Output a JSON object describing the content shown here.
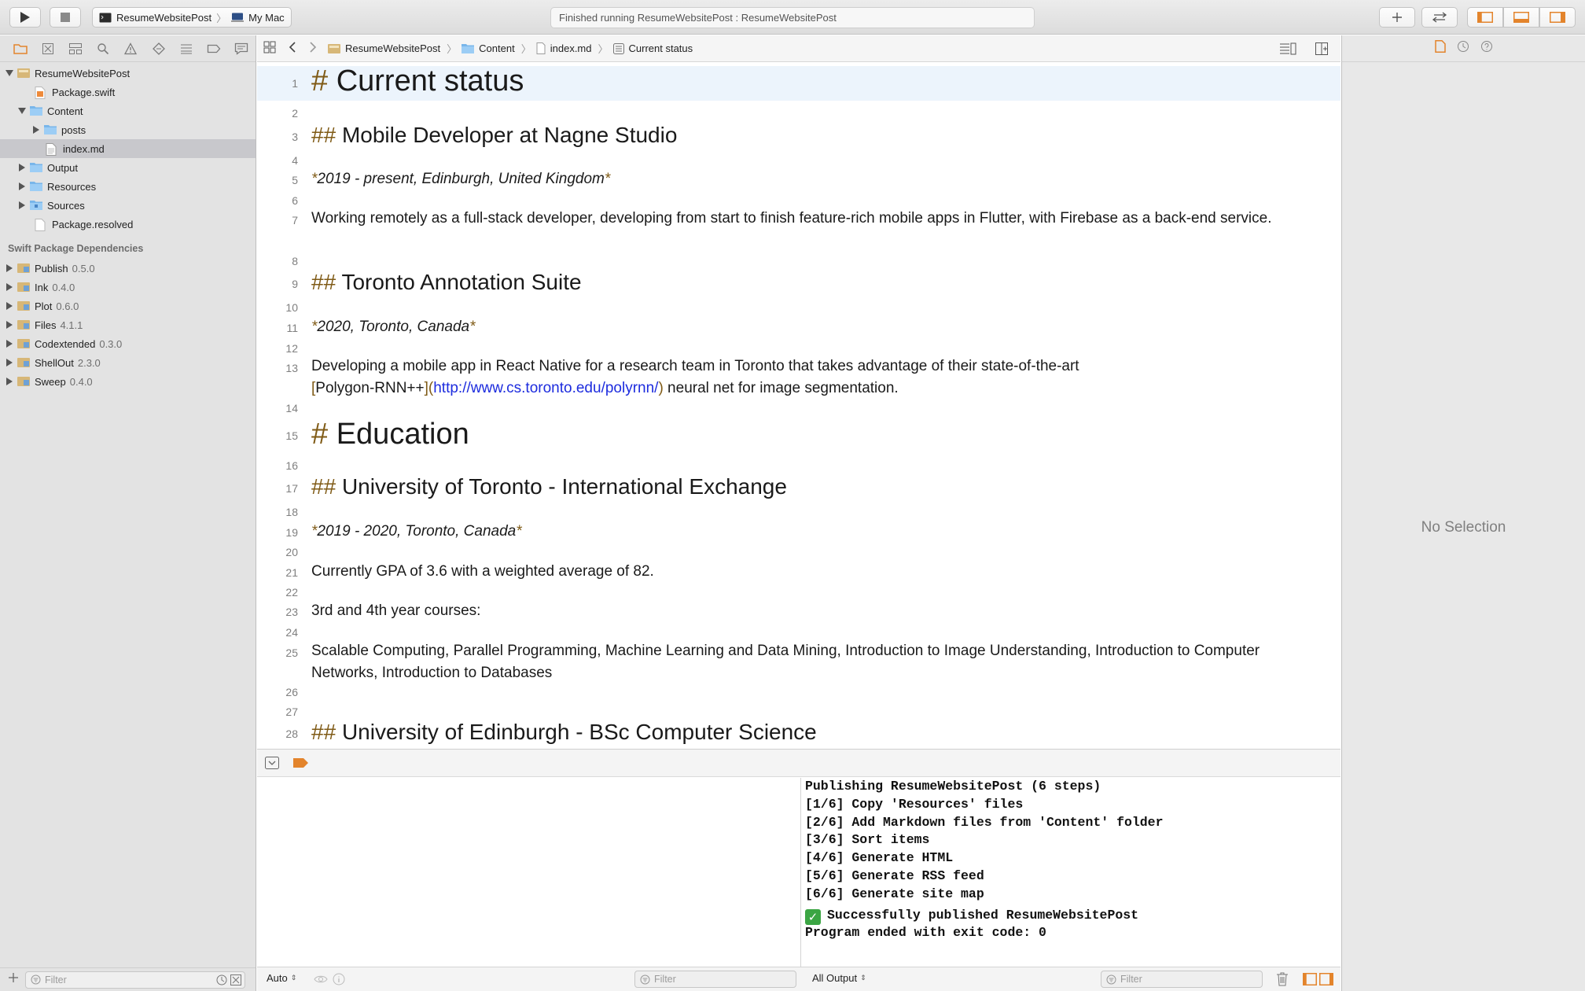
{
  "toolbar": {
    "scheme_name": "ResumeWebsitePost",
    "destination": "My Mac",
    "activity_status": "Finished running ResumeWebsitePost : ResumeWebsitePost"
  },
  "navigator": {
    "project": "ResumeWebsitePost",
    "files": [
      {
        "name": "Package.swift"
      },
      {
        "name": "Content"
      },
      {
        "name": "posts"
      },
      {
        "name": "index.md"
      },
      {
        "name": "Output"
      },
      {
        "name": "Resources"
      },
      {
        "name": "Sources"
      },
      {
        "name": "Package.resolved"
      }
    ],
    "deps_header": "Swift Package Dependencies",
    "dependencies": [
      {
        "name": "Publish",
        "version": "0.5.0"
      },
      {
        "name": "Ink",
        "version": "0.4.0"
      },
      {
        "name": "Plot",
        "version": "0.6.0"
      },
      {
        "name": "Files",
        "version": "4.1.1"
      },
      {
        "name": "Codextended",
        "version": "0.3.0"
      },
      {
        "name": "ShellOut",
        "version": "2.3.0"
      },
      {
        "name": "Sweep",
        "version": "0.4.0"
      }
    ],
    "filter_placeholder": "Filter"
  },
  "jumpbar": {
    "crumbs": [
      "ResumeWebsitePost",
      "Content",
      "index.md",
      "Current status"
    ]
  },
  "editor": {
    "lines": [
      {
        "n": "1",
        "mark": "#",
        "text": "Current status"
      },
      {
        "n": "2"
      },
      {
        "n": "3",
        "mark": "##",
        "text": "Mobile Developer at Nagne Studio"
      },
      {
        "n": "4"
      },
      {
        "n": "5",
        "text": "2019 - present, Edinburgh, United Kingdom"
      },
      {
        "n": "6"
      },
      {
        "n": "7",
        "text": "Working remotely as a full-stack developer, developing  from start to finish feature-rich mobile apps in Flutter, with Firebase as a back-end service."
      },
      {
        "n": "8"
      },
      {
        "n": "9",
        "mark": "##",
        "text": "Toronto Annotation Suite"
      },
      {
        "n": "10"
      },
      {
        "n": "11",
        "text": "2020, Toronto, Canada"
      },
      {
        "n": "12"
      },
      {
        "n": "13",
        "text": "Developing a mobile app in React Native for a research team in Toronto that takes advantage of their state-of-the-art",
        "link_text": "Polygon-RNN++",
        "link_url": "http://www.cs.toronto.edu/polyrnn/",
        "tail": " neural net for image segmentation."
      },
      {
        "n": "14"
      },
      {
        "n": "15",
        "mark": "#",
        "text": "Education"
      },
      {
        "n": "16"
      },
      {
        "n": "17",
        "mark": "##",
        "text": "University of Toronto - International Exchange"
      },
      {
        "n": "18"
      },
      {
        "n": "19",
        "text": "2019 - 2020, Toronto, Canada"
      },
      {
        "n": "20"
      },
      {
        "n": "21",
        "text": "Currently GPA of 3.6 with a weighted average of 82."
      },
      {
        "n": "22"
      },
      {
        "n": "23",
        "text": "3rd and 4th year courses:"
      },
      {
        "n": "24"
      },
      {
        "n": "25",
        "text": "Scalable Computing, Parallel Programming, Machine Learning and Data Mining, Introduction to Image Understanding, Introduction to Computer Networks, Introduction to Databases"
      },
      {
        "n": "26"
      },
      {
        "n": "27"
      },
      {
        "n": "28",
        "mark": "##",
        "text": "University of Edinburgh - BSc Computer Science"
      }
    ]
  },
  "console": {
    "lines": [
      "Publishing ResumeWebsitePost (6 steps)",
      "[1/6] Copy 'Resources' files",
      "[2/6] Add Markdown files from 'Content' folder",
      "[3/6] Sort items",
      "[4/6] Generate HTML",
      "[5/6] Generate RSS feed",
      "[6/6] Generate site map"
    ],
    "success": "Successfully published ResumeWebsitePost",
    "exit": "Program ended with exit code: 0",
    "output_selector": "All Output",
    "filter_placeholder": "Filter"
  },
  "variables": {
    "mode": "Auto",
    "filter_placeholder": "Filter"
  },
  "inspector": {
    "empty_label": "No Selection"
  },
  "colors": {
    "markdown_marker": "#7f5a15",
    "link": "#1d2cde",
    "accent_orange": "#e3842c",
    "current_line": "#ecf4fc"
  }
}
